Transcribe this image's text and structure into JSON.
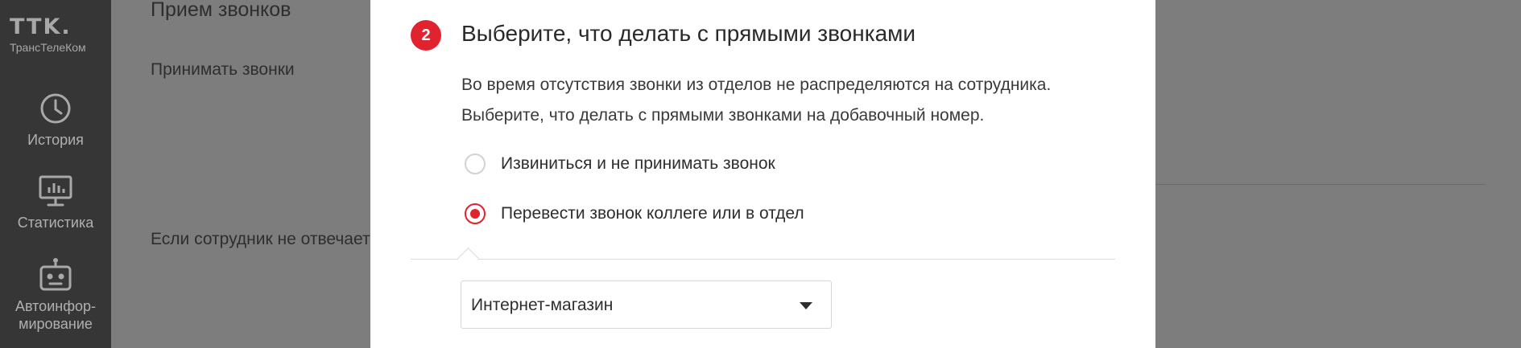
{
  "sidebar": {
    "logo": {
      "mark": "TTK.",
      "subtitle": "ТрансТелеКом"
    },
    "items": [
      {
        "label": "История",
        "icon": "clock-icon"
      },
      {
        "label": "Статистика",
        "icon": "chart-monitor-icon"
      },
      {
        "label_line1": "Автоинфор-",
        "label_line2": "мирование",
        "icon": "robot-icon"
      }
    ]
  },
  "background": {
    "title": "Прием звонков",
    "accept_calls_label": "Принимать звонки",
    "no_answer_label": "Если сотрудник не отвечает"
  },
  "modal": {
    "step_number": "2",
    "title": "Выберите, что делать с прямыми звонками",
    "description_line1": "Во время отсутствия звонки из отделов не распределяются на сотрудника.",
    "description_line2": "Выберите, что делать с прямыми звонками на добавочный номер.",
    "options": [
      {
        "label": "Извиниться и не принимать звонок",
        "selected": false
      },
      {
        "label": "Перевести звонок коллеге или в отдел",
        "selected": true
      }
    ],
    "transfer_select": {
      "value": "Интернет-магазин"
    }
  },
  "colors": {
    "accent": "#e0232e",
    "sidebar_bg": "#363636",
    "overlay_bg": "#7d7d7d",
    "modal_bg": "#ffffff"
  }
}
